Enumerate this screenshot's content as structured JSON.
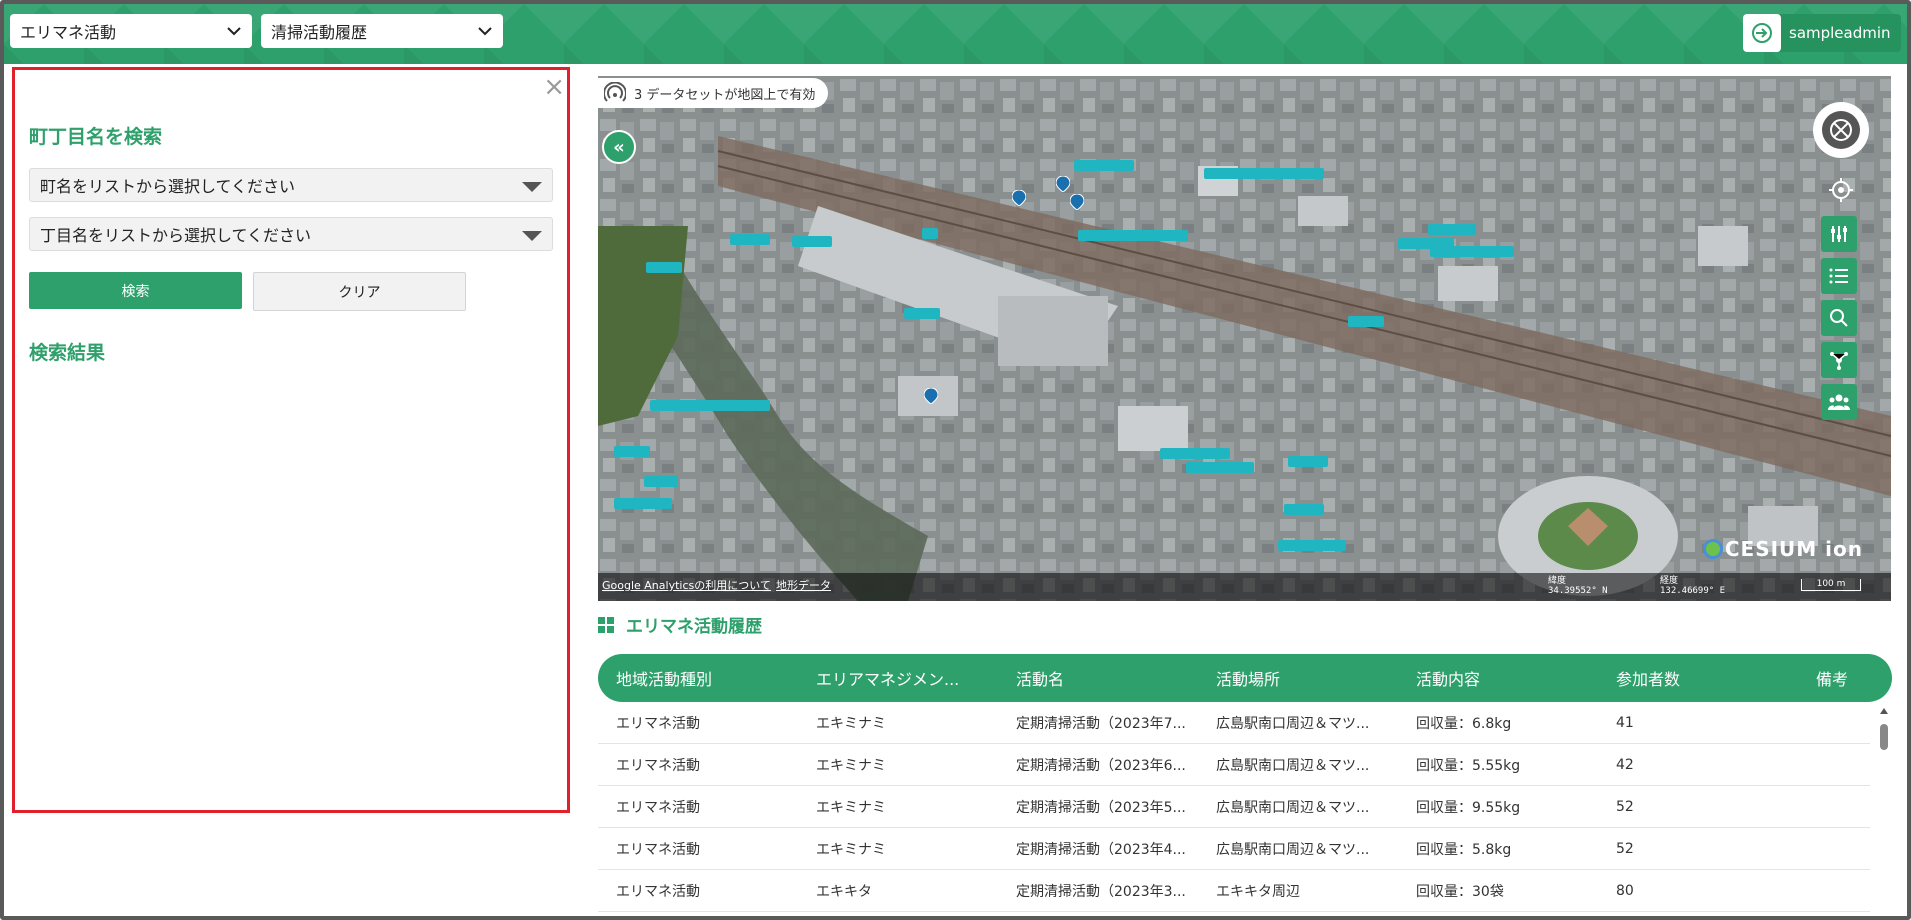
{
  "header": {
    "category_select": "エリマネ活動",
    "history_select": "清掃活動履歴",
    "user_name": "sampleadmin"
  },
  "search_panel": {
    "title": "町丁目名を検索",
    "town_placeholder": "町名をリストから選択してください",
    "chome_placeholder": "丁目名をリストから選択してください",
    "search_label": "検索",
    "clear_label": "クリア",
    "results_title": "検索結果",
    "close_icon": "close-icon"
  },
  "map": {
    "dataset_status": "3 データセットが地図上で有効",
    "footer_link_analytics": "Google Analyticsの利用について",
    "footer_link_terrain": "地形データ",
    "lat_label": "緯度",
    "lat_value": "34.39552° N",
    "lon_label": "経度",
    "lon_value": "132.46699° E",
    "scale_label": "100 m",
    "brand": "CESIUM ion"
  },
  "table_section": {
    "title": "エリマネ活動履歴",
    "columns": [
      "地域活動種別",
      "エリアマネジメン...",
      "活動名",
      "活動場所",
      "活動内容",
      "参加者数",
      "備考"
    ],
    "rows": [
      [
        "エリマネ活動",
        "エキミナミ",
        "定期清掃活動（2023年7...",
        "広島駅南口周辺＆マツ...",
        "回収量：6.8kg",
        "41",
        ""
      ],
      [
        "エリマネ活動",
        "エキミナミ",
        "定期清掃活動（2023年6...",
        "広島駅南口周辺＆マツ...",
        "回収量：5.55kg",
        "42",
        ""
      ],
      [
        "エリマネ活動",
        "エキミナミ",
        "定期清掃活動（2023年5...",
        "広島駅南口周辺＆マツ...",
        "回収量：9.55kg",
        "52",
        ""
      ],
      [
        "エリマネ活動",
        "エキミナミ",
        "定期清掃活動（2023年4...",
        "広島駅南口周辺＆マツ...",
        "回収量：5.8kg",
        "52",
        ""
      ],
      [
        "エリマネ活動",
        "エキキタ",
        "定期清掃活動（2023年3...",
        "エキキタ周辺",
        "回収量：30袋",
        "80",
        ""
      ]
    ]
  },
  "colors": {
    "accent": "#2ea06c",
    "highlight_border": "#e0202a",
    "map_label": "#1fb6c1"
  }
}
